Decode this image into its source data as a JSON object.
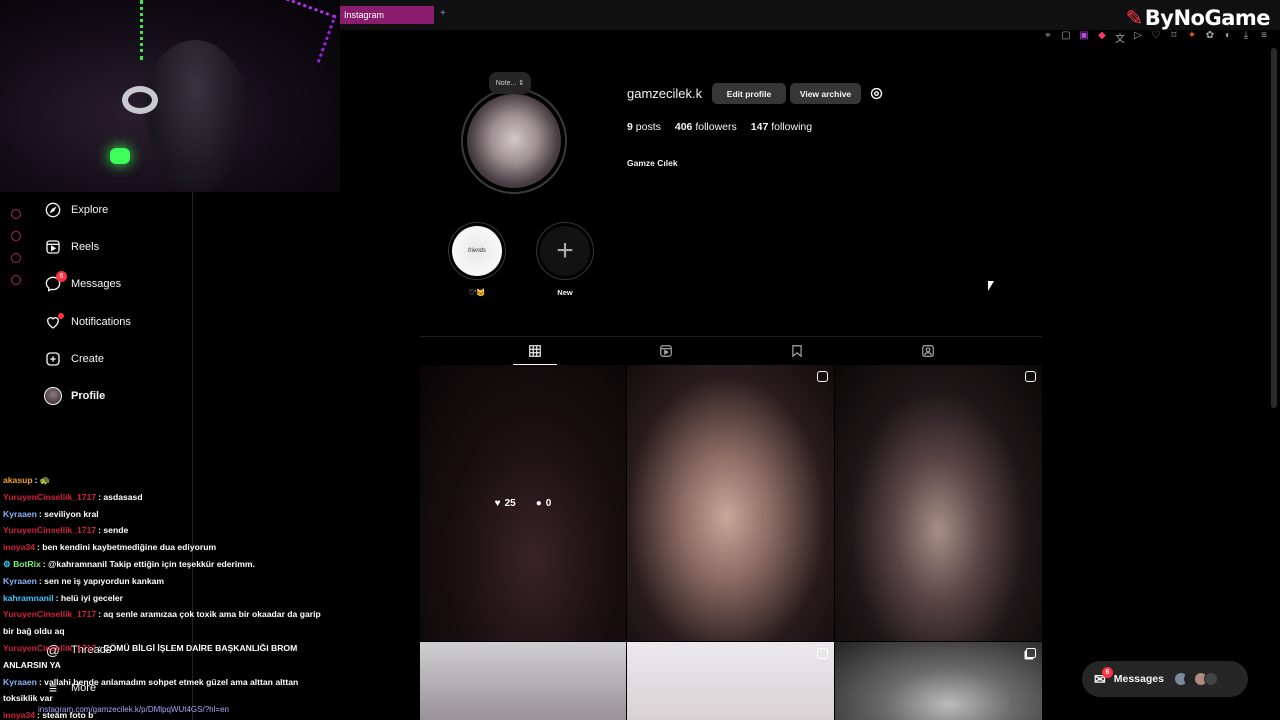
{
  "browser": {
    "tab_title": "Instagram",
    "tab_add": "+",
    "brand": "ByNoGame",
    "url": "instagram.com/gamzecilek.k/p/DMlpqWUt4GS/?hl=en"
  },
  "sidebar": {
    "items": [
      {
        "label": "Explore",
        "icon": "compass-icon"
      },
      {
        "label": "Reels",
        "icon": "reels-icon"
      },
      {
        "label": "Messages",
        "icon": "messenger-icon",
        "badge": "6"
      },
      {
        "label": "Notifications",
        "icon": "heart-icon"
      },
      {
        "label": "Create",
        "icon": "plus-square-icon"
      },
      {
        "label": "Profile",
        "icon": "avatar"
      }
    ],
    "threads_label": "Threads",
    "more_label": "More"
  },
  "profile": {
    "note_placeholder": "Note...",
    "username": "gamzecilek.k",
    "edit_profile": "Edit profile",
    "view_archive": "View archive",
    "posts_count": "9",
    "posts_label": "posts",
    "followers_count": "406",
    "followers_label": "followers",
    "following_count": "147",
    "following_label": "following",
    "full_name": "Gamze Cılek"
  },
  "highlights": [
    {
      "label": "♡'🐱",
      "cover_text": "friends"
    },
    {
      "label": "New"
    }
  ],
  "grid": {
    "hover_likes": "25",
    "hover_comments": "0"
  },
  "chat": [
    {
      "user": "akasup",
      "color": "#f0a020",
      "text": ": 🐢"
    },
    {
      "user": "YuruyenCinsellik_1717",
      "color": "#d0203a",
      "text": ": asdasasd"
    },
    {
      "user": "Kyraaen",
      "color": "#8ab4f8",
      "text": ": seviliyon kral"
    },
    {
      "user": "YuruyenCinsellik_1717",
      "color": "#d0203a",
      "text": ": sende"
    },
    {
      "user": "inoya34",
      "color": "#d0203a",
      "text": ": ben kendini kaybetmediğine dua ediyorum"
    },
    {
      "user": "BotRix",
      "color": "#7cf07c",
      "text": ": @kahramnanil Takip ettiğin için teşekkür ederimm."
    },
    {
      "user": "Kyraaen",
      "color": "#8ab4f8",
      "text": ": sen ne iş yapıyordun kankam"
    },
    {
      "user": "kahramnanil",
      "color": "#3ec6ff",
      "text": ": helü iyi geceler"
    },
    {
      "user": "YuruyenCinsellik_1717",
      "color": "#d0203a",
      "text": ": aq senle aramızaa çok toxik ama bir okaadar da garip bir bağ oldu aq"
    },
    {
      "user": "YuruyenCinsellik_1717",
      "color": "#d0203a",
      "text": ": ÇÖMÜ BİLGİ İŞLEM DAİRE BAŞKANLIĞI BROM ANLARSIN YA"
    },
    {
      "user": "Kyraaen",
      "color": "#8ab4f8",
      "text": ": vallahi bende anlamadım sohpet etmek güzel ama alttan alttan toksiklik var"
    },
    {
      "user": "inoya34",
      "color": "#d0203a",
      "text": ": steam foto b"
    }
  ],
  "messages_pill": {
    "label": "Messages",
    "badge": "6"
  },
  "colors": {
    "accent": "#8a1d6d",
    "badge": "#ff3040",
    "button": "#363636"
  }
}
